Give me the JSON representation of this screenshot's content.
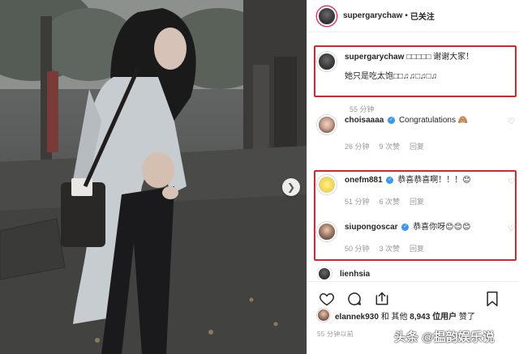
{
  "post": {
    "author": "supergarychaw",
    "separator": "•",
    "follow_state": "已关注",
    "photo_alt_subject": "woman in denim jacket on street"
  },
  "comments": [
    {
      "username": "supergarychaw",
      "verified": false,
      "text_line1": "□□□□□ 谢谢大家！",
      "text_line2": "她只是吃太饱□□♫♫□♫□♫",
      "time": "55 分钟",
      "likes": "",
      "reply": "",
      "avatar": "avatar-dark"
    },
    {
      "username": "choisaaaa",
      "verified": true,
      "text": "Congratulations 🙈",
      "time": "26 分钟",
      "likes": "9 次赞",
      "reply": "回复",
      "avatar": "avatar-female"
    },
    {
      "username": "onefm881",
      "verified": true,
      "text": "恭喜恭喜啊！！！😊",
      "time": "51 分钟",
      "likes": "6 次赞",
      "reply": "回复",
      "avatar": "avatar-cartoon"
    },
    {
      "username": "siupongoscar",
      "verified": true,
      "text": "恭喜你呀😊😊😊",
      "time": "50 分钟",
      "likes": "3 次赞",
      "reply": "回复",
      "avatar": "avatar-man"
    }
  ],
  "partial_comment": {
    "username": "lienhsia"
  },
  "likes_summary": {
    "liker": "elannek930",
    "connector": "和 其他",
    "count": "8,943 位用户",
    "suffix": "赞了"
  },
  "timestamp": "55 分钟以前",
  "watermark": "头条 @揾韵娱乐说",
  "icons": [
    "heart-icon",
    "comment-icon",
    "share-icon",
    "bookmark-icon",
    "verified-icon",
    "chevron-right-icon"
  ],
  "colors": {
    "highlight_box": "#d8262f",
    "verified": "#3897f0",
    "meta_text": "#999999"
  }
}
